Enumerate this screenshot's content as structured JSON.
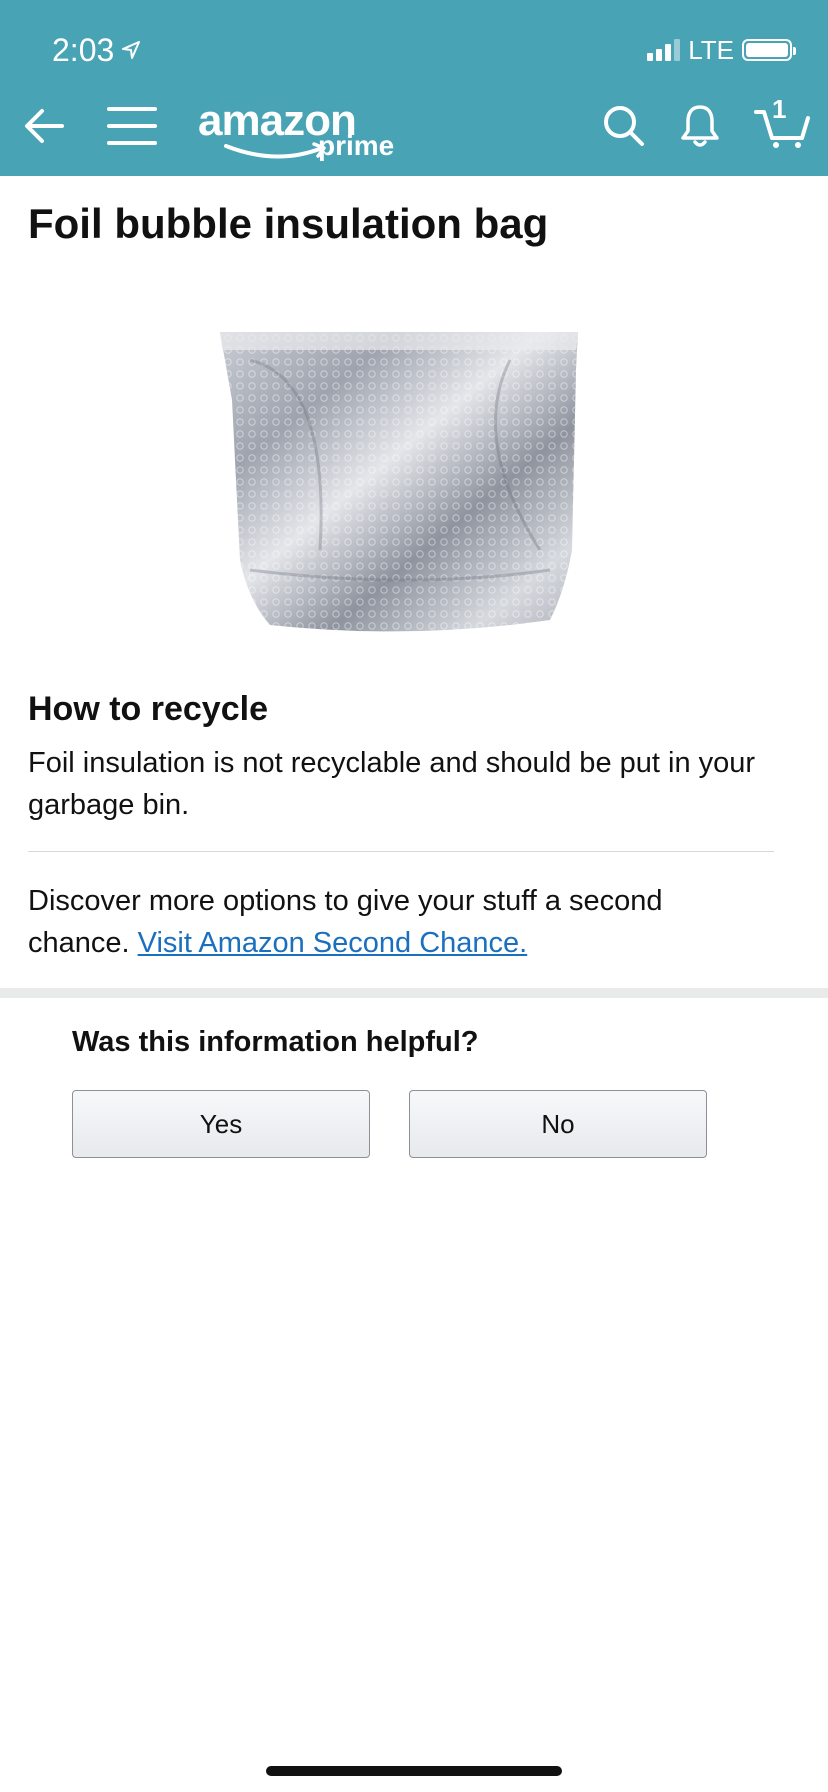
{
  "status_bar": {
    "time": "2:03",
    "network": "LTE"
  },
  "header": {
    "logo_text": "amazon",
    "logo_sub": "prime",
    "cart_count": "1",
    "background": "#48a3b5"
  },
  "page": {
    "title": "Foil bubble insulation bag",
    "image_icon": "foil-bubble-bag-photo",
    "how_to_recycle": {
      "heading": "How to recycle",
      "text": "Foil insulation is not recyclable and should be put in your garbage bin."
    },
    "discover": {
      "text": "Discover more options to give your stuff a second chance. ",
      "link_label": "Visit Amazon Second Chance."
    },
    "feedback": {
      "question": "Was this information helpful?",
      "yes_label": "Yes",
      "no_label": "No"
    }
  },
  "colors": {
    "accent": "#48a3b5",
    "link": "#1a6fbf"
  }
}
